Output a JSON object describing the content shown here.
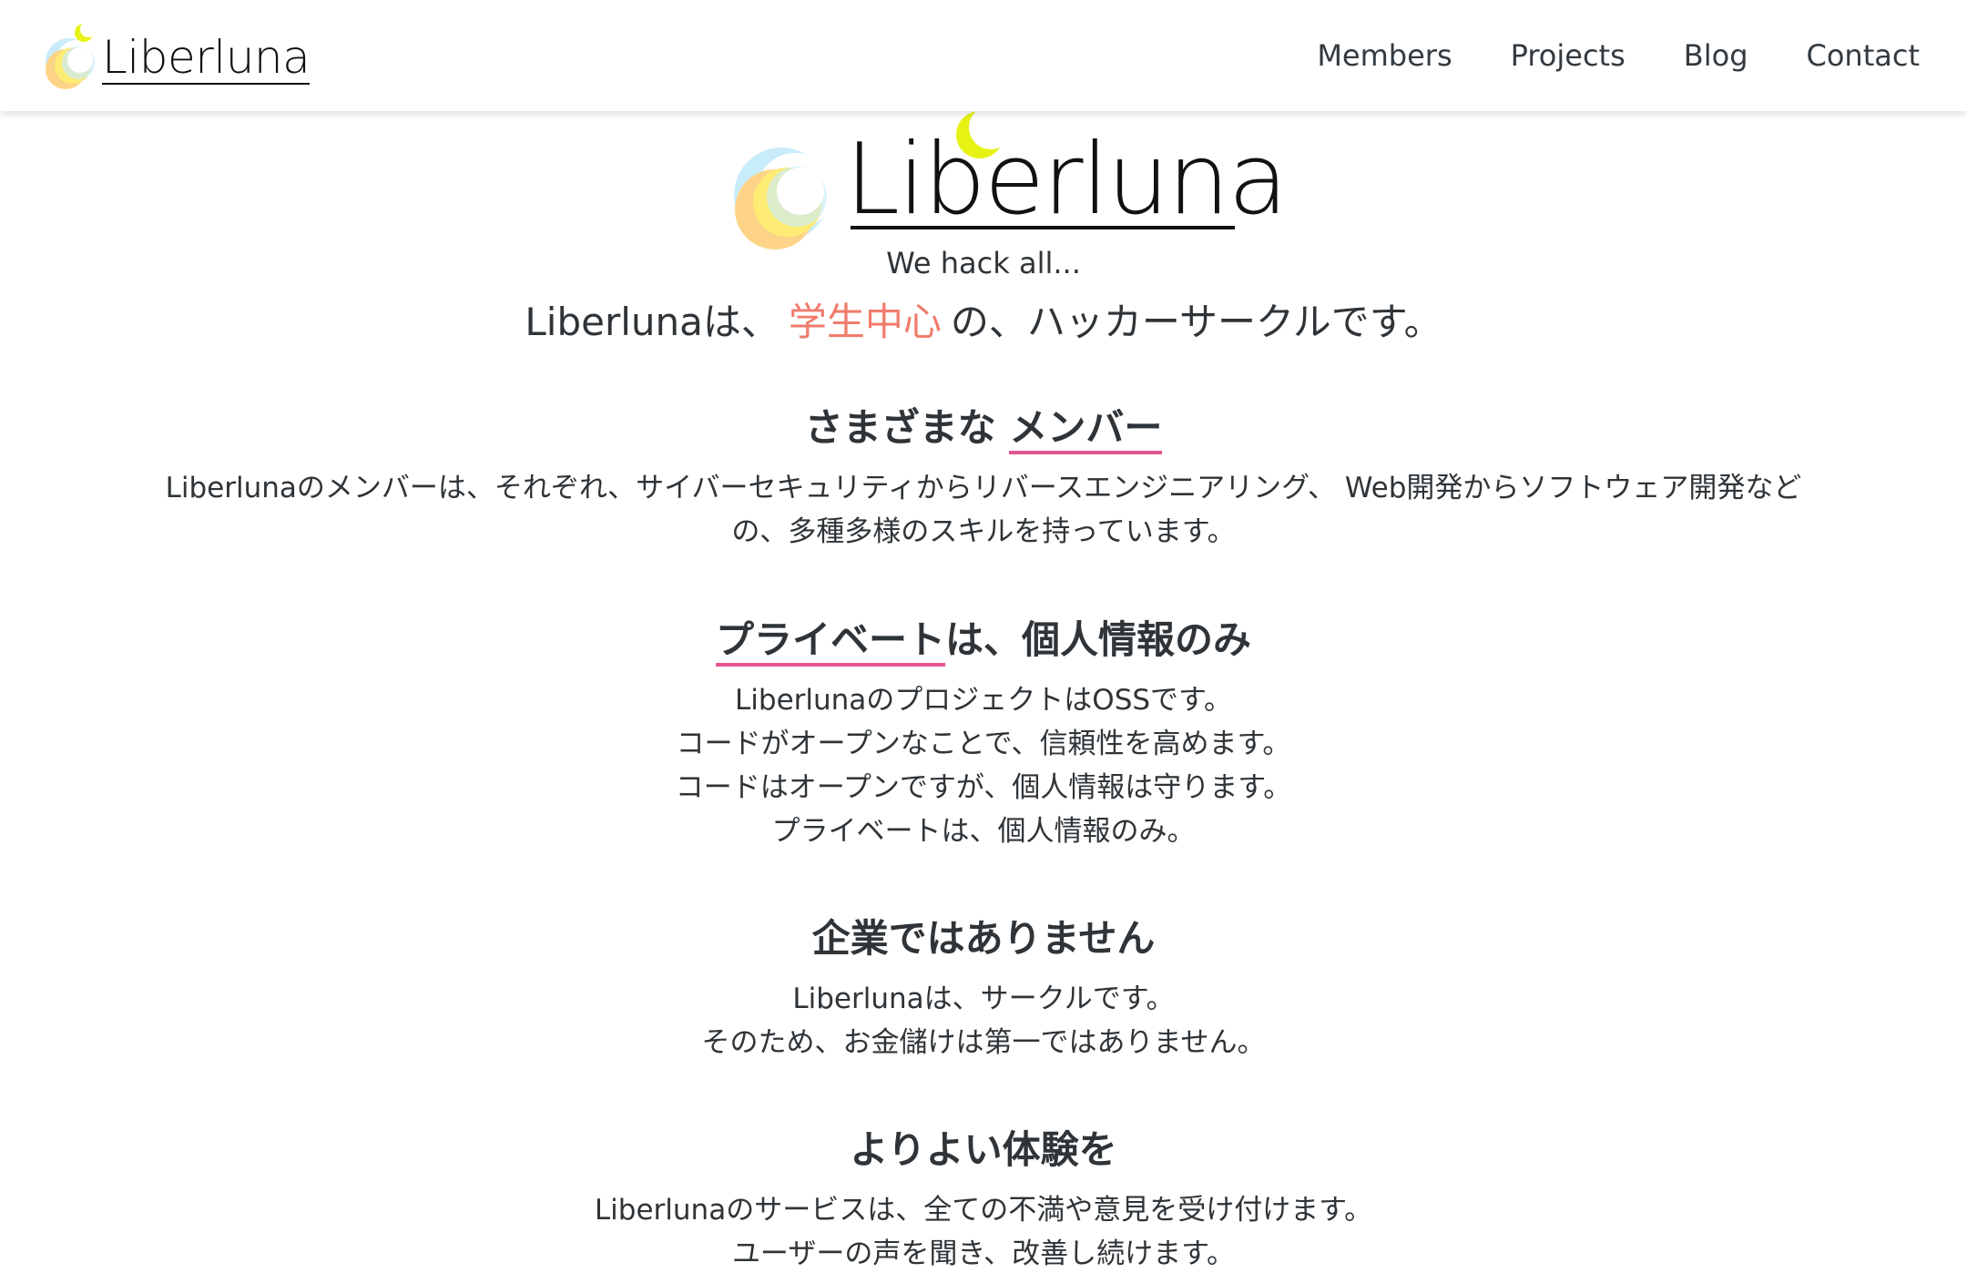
{
  "header": {
    "brand": "Liberluna",
    "nav": [
      "Members",
      "Projects",
      "Blog",
      "Contact"
    ]
  },
  "hero": {
    "title": "Liberluna",
    "tagline": "We hack all...",
    "lead_pre": "Liberlunaは、",
    "lead_accent": "学生中心",
    "lead_post": "の、ハッカーサークルです。"
  },
  "sections": {
    "members": {
      "title_pre": "さまざまな",
      "title_highlight": "メンバー",
      "body": "Liberlunaのメンバーは、それぞれ、サイバーセキュリティからリバースエンジニアリング、 Web開発からソフトウェア開発などの、多種多様のスキルを持っています。"
    },
    "private": {
      "title_highlight": "プライベート",
      "title_post": "は、個人情報のみ",
      "lines": [
        "LiberlunaのプロジェクトはOSSです。",
        "コードがオープンなことで、信頼性を高めます。",
        "コードはオープンですが、個人情報は守ります。",
        "プライベートは、個人情報のみ。"
      ]
    },
    "company": {
      "title": "企業ではありません",
      "lines": [
        "Liberlunaは、サークルです。",
        "そのため、お金儲けは第一ではありません。"
      ]
    },
    "experience": {
      "title": "よりよい体験を",
      "lines": [
        "Liberlunaのサービスは、全ての不満や意見を受け付けます。",
        "ユーザーの声を聞き、改善し続けます。"
      ]
    }
  },
  "colors": {
    "accent": "#f07c6c",
    "highlight_underline": "#e25592",
    "logo_blue": "#c9ecfb",
    "logo_yellow": "#fdeb73",
    "logo_orange": "#fdd487",
    "logo_moon": "#e5f214"
  },
  "icons": {
    "brand_logo": "crescent-moon-logo-icon"
  }
}
